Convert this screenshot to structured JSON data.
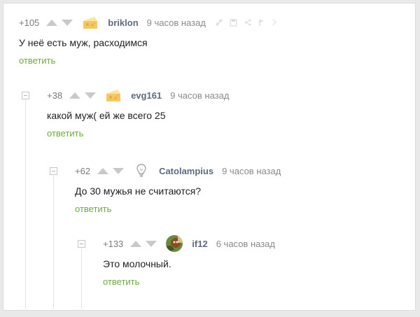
{
  "comments": [
    {
      "rating": "+105",
      "username": "briklon",
      "time": "9 часов назад",
      "text": "У неё есть муж, расходимся",
      "reply": "ответить",
      "avatar": "cheese-icon"
    },
    {
      "rating": "+38",
      "username": "evg161",
      "time": "9 часов назад",
      "text": "какой муж( ей же всего 25",
      "reply": "ответить",
      "avatar": "cheese-icon"
    },
    {
      "rating": "+62",
      "username": "Catolampius",
      "time": "9 часов назад",
      "text": "До 30 мужья не считаются?",
      "reply": "ответить",
      "avatar": "lightbulb-icon"
    },
    {
      "rating": "+133",
      "username": "if12",
      "time": "6 часов назад",
      "text": "Это молочный.",
      "reply": "ответить",
      "avatar": "user-photo"
    }
  ],
  "colors": {
    "username": "#5d6a80",
    "reply": "#6cad3a",
    "vote": "#c9c9c9",
    "text": "#222222"
  }
}
